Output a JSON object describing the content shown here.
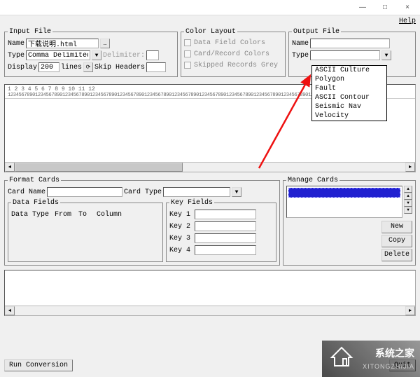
{
  "titlebar": {
    "minimize": "—",
    "maximize": "□",
    "close": "×"
  },
  "menu": {
    "help": "Help"
  },
  "input_file": {
    "legend": "Input File",
    "name_lbl": "Name",
    "name_val": "下载说明.html",
    "type_lbl": "Type",
    "type_val": "Comma Delimited",
    "delimiter_lbl": "Delimiter:",
    "display_lbl": "Display",
    "display_val": "200",
    "display_unit": "lines",
    "skip_lbl": "Skip Headers",
    "skip_val": ""
  },
  "color_layout": {
    "legend": "Color Layout",
    "opt1": "Data Field Colors",
    "opt2": "Card/Record Colors",
    "opt3": "Skipped Records Grey"
  },
  "output_file": {
    "legend": "Output File",
    "name_lbl": "Name",
    "name_val": "",
    "type_lbl": "Type",
    "type_val": ""
  },
  "type_dropdown": {
    "items": [
      "ASCII Culture",
      "Polygon",
      "Fault",
      "ASCII Contour",
      "Seismic Nav",
      "Velocity"
    ]
  },
  "ruler": {
    "nums": "       1         2         3         4         5         6         7         8         9        10        11        12",
    "ticks": "12345678901234567890123456789012345678901234567890123456789012345678901234567890123456789012345678901234567890123456789012345"
  },
  "format_cards": {
    "legend": "Format Cards",
    "card_name_lbl": "Card Name",
    "card_name_val": "",
    "card_type_lbl": "Card Type",
    "card_type_val": ""
  },
  "data_fields": {
    "legend": "Data Fields",
    "col_datatype": "Data Type",
    "col_from": "From",
    "col_to": "To",
    "col_column": "Column"
  },
  "key_fields": {
    "legend": "Key Fields",
    "k1_lbl": "Key 1",
    "k1_val": "",
    "k2_lbl": "Key 2",
    "k2_val": "",
    "k3_lbl": "Key 3",
    "k3_val": "",
    "k4_lbl": "Key 4",
    "k4_val": ""
  },
  "manage_cards": {
    "legend": "Manage Cards",
    "new_btn": "New",
    "copy_btn": "Copy",
    "delete_btn": "Delete"
  },
  "footer": {
    "run": "Run Conversion",
    "quit": "Quit"
  },
  "watermark": {
    "line1": "系统之家",
    "line2": "XITONGZHIJIA"
  }
}
